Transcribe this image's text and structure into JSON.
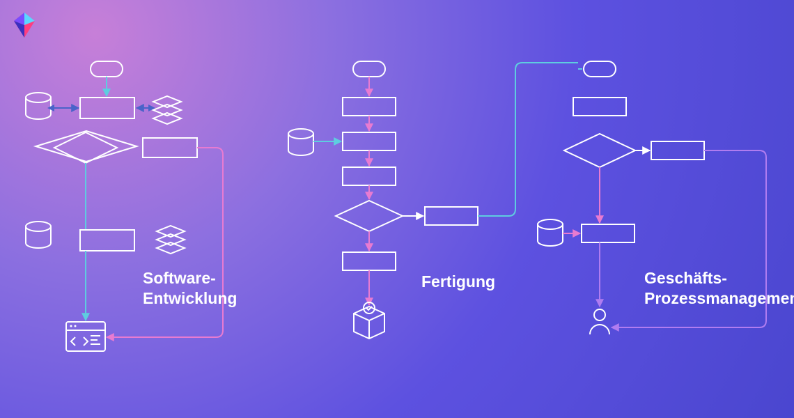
{
  "labels": {
    "software": "Software-\nEntwicklung",
    "fertigung": "Fertigung",
    "bpm": "Geschäfts-\nProzessmanagement"
  },
  "colors": {
    "shape": "#ffffff",
    "cyan": "#5ecde0",
    "pink": "#e87bd1",
    "violet": "#b07cf0",
    "blue": "#4a63c9"
  },
  "diagrams": [
    {
      "name": "software-development",
      "shapes": [
        "pill",
        "process",
        "database",
        "stack",
        "decision",
        "process",
        "database",
        "process",
        "stack",
        "code-window"
      ],
      "flows": [
        "start->process",
        "process<->db",
        "process<->stack",
        "process->decision",
        "decision->process2",
        "process2->end"
      ]
    },
    {
      "name": "manufacturing",
      "shapes": [
        "pill",
        "process",
        "database",
        "process",
        "process",
        "decision",
        "process",
        "process",
        "package"
      ],
      "flows": [
        "start->p1",
        "p1->p2",
        "db->p2",
        "p2->p3",
        "p3->decision",
        "decision->side",
        "decision->p4",
        "p4->package",
        "side->loop-back"
      ]
    },
    {
      "name": "business-process-management",
      "shapes": [
        "pill",
        "process",
        "decision",
        "process",
        "database",
        "process",
        "user"
      ],
      "flows": [
        "start->p1",
        "p1->decision",
        "decision->side",
        "decision->p2",
        "db->p2",
        "p2->user",
        "side->user",
        "loop-to-start"
      ]
    }
  ]
}
